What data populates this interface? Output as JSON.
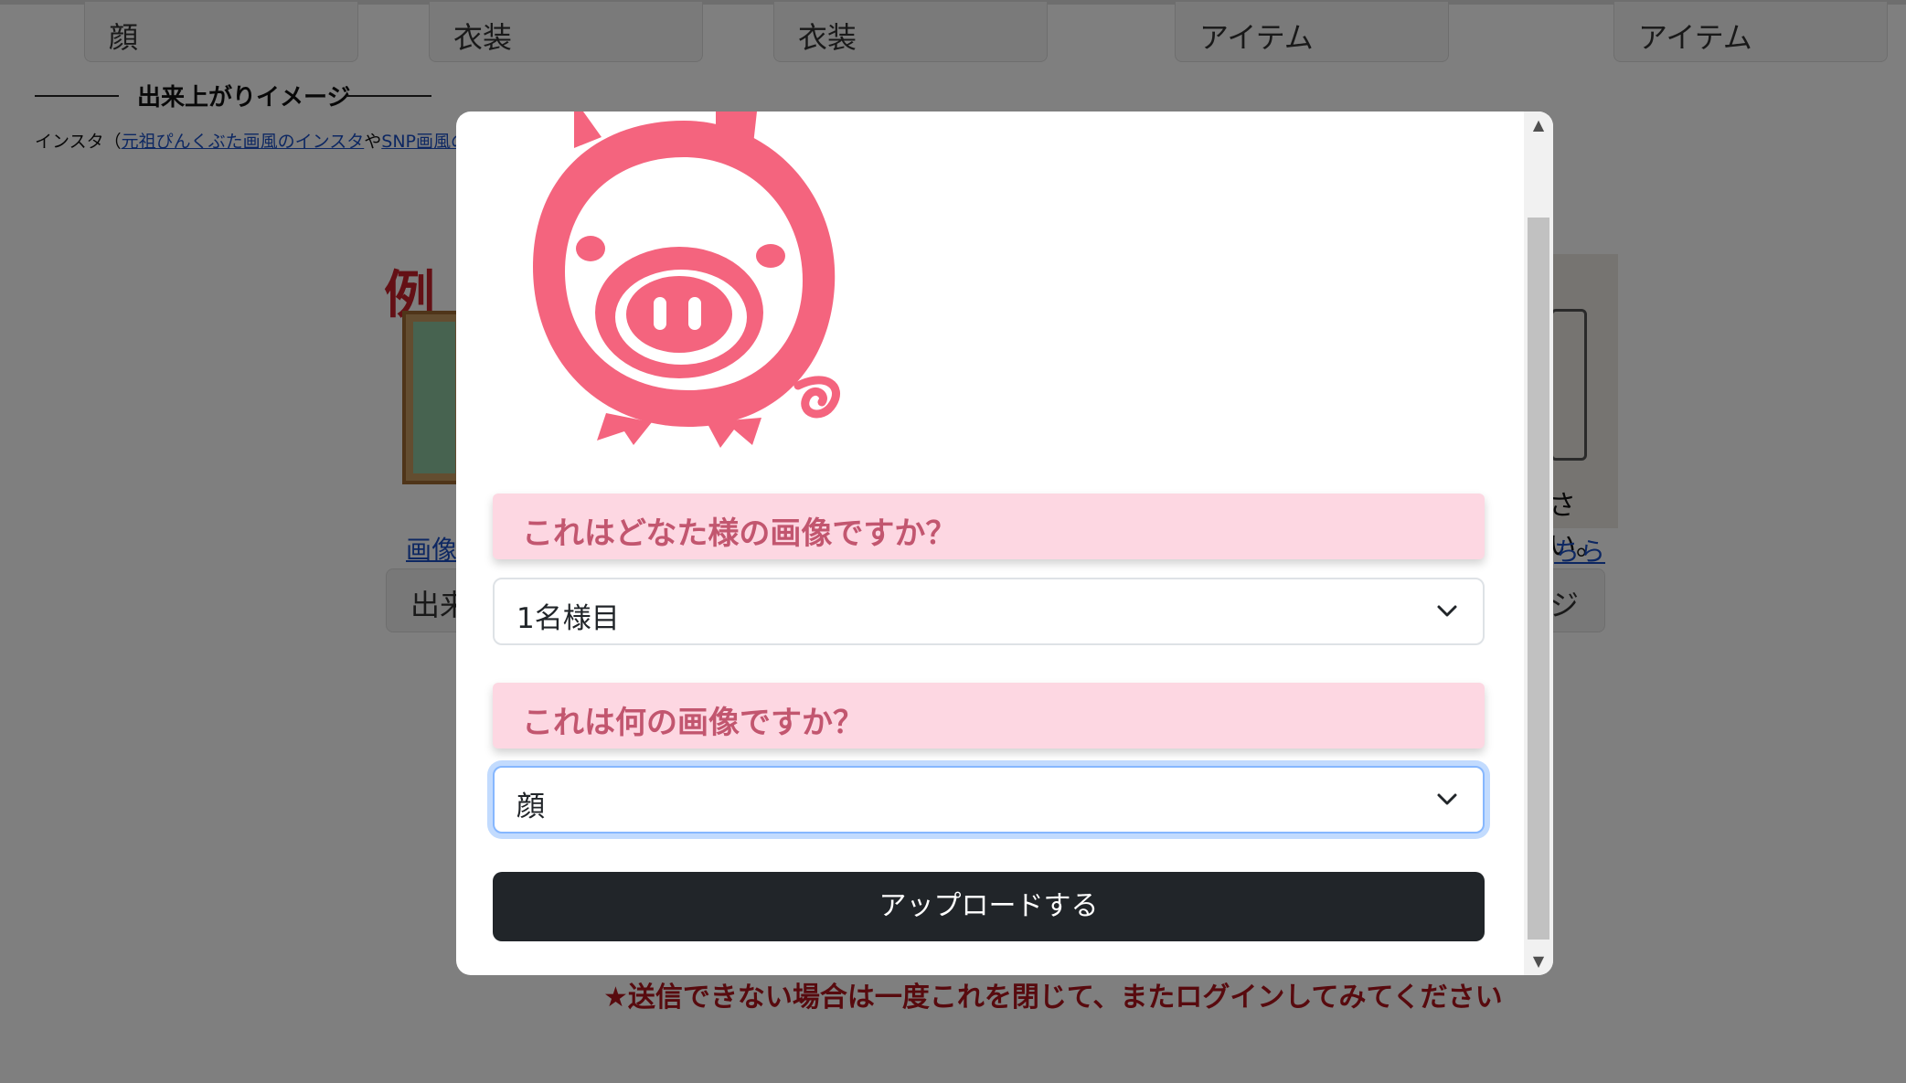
{
  "background": {
    "category_tabs": [
      "顔",
      "衣装",
      "衣装",
      "アイテム",
      "アイテム"
    ],
    "section_title": "出来上がりイメージ",
    "insta_prefix": "インスタ（",
    "insta_link_1": "元祖ぴんくぶた画風のインスタ",
    "insta_middle": "や",
    "insta_link_2": "SNP画風のインス",
    "example_mark": "例",
    "left_link": "画像",
    "left_button": "出来",
    "right_caption": "さい。",
    "right_link": "ちら",
    "right_button": "ジ",
    "warning": "★送信できない場合は一度これを閉じて、またログインしてみてください"
  },
  "modal": {
    "question_person": "これはどなた様の画像ですか？",
    "person_select_value": "1名様目",
    "question_type": "これは何の画像ですか？",
    "type_select_value": "顔",
    "upload_button": "アップロードする"
  },
  "colors": {
    "pig_pink": "#f4647e",
    "label_bg": "#fdd7e2",
    "label_text": "#c2566f",
    "button_dark": "#212529",
    "warning_red": "#b0141c"
  }
}
